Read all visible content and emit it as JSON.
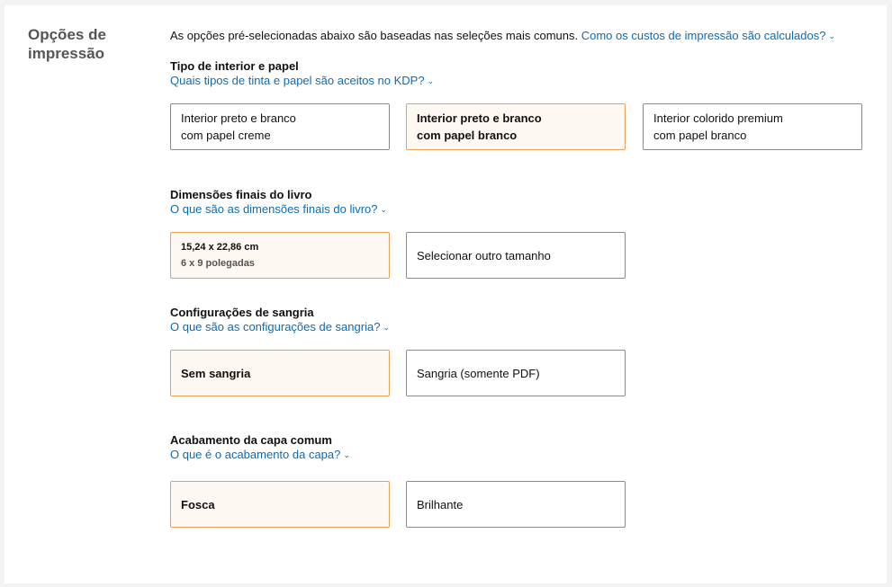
{
  "section_title": "Opções de impressão",
  "intro": {
    "text": "As opções pré-selecionadas abaixo são baseadas nas seleções mais comuns.",
    "link": "Como os custos de impressão são calculados?"
  },
  "interior": {
    "label": "Tipo de interior e papel",
    "link": "Quais tipos de tinta e papel são aceitos no KDP?",
    "options": [
      {
        "line1": "Interior preto e branco",
        "line2": "com papel creme",
        "selected": false
      },
      {
        "line1": "Interior preto e branco",
        "line2": "com papel branco",
        "selected": true
      },
      {
        "line1": "Interior colorido premium",
        "line2": "com papel branco",
        "selected": false
      }
    ]
  },
  "trim": {
    "label": "Dimensões finais do livro",
    "link": "O que são as dimensões finais do livro?",
    "options": [
      {
        "line1": "15,24 x 22,86 cm",
        "line2": "6 x 9 polegadas",
        "selected": true
      },
      {
        "line1": "Selecionar outro tamanho",
        "selected": false
      }
    ]
  },
  "bleed": {
    "label": "Configurações de sangria",
    "link": "O que são as configurações de sangria?",
    "options": [
      {
        "line1": "Sem sangria",
        "selected": true
      },
      {
        "line1": "Sangria (somente PDF)",
        "selected": false
      }
    ]
  },
  "cover": {
    "label": "Acabamento da capa comum",
    "link": "O que é o acabamento da capa?",
    "options": [
      {
        "line1": "Fosca",
        "selected": true
      },
      {
        "line1": "Brilhante",
        "selected": false
      }
    ]
  },
  "colors": {
    "selected_bg": "#fef8f2",
    "selected_border": "#e3a25b",
    "link": "#0f6bb0"
  }
}
